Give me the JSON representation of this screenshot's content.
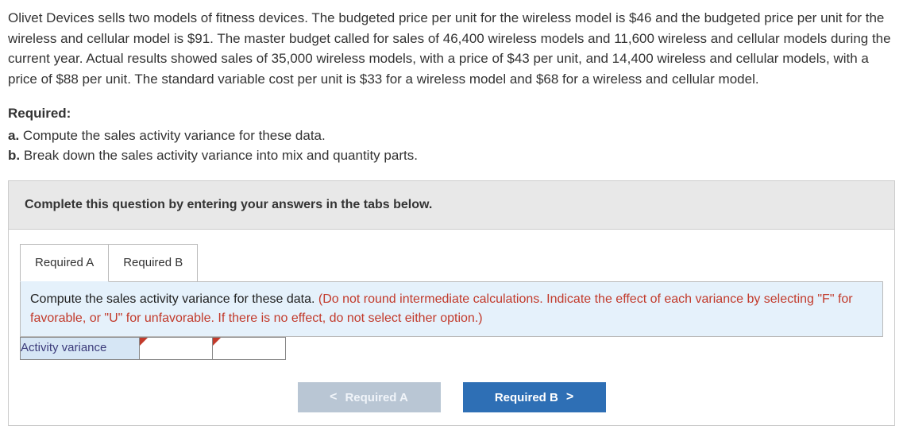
{
  "question": {
    "body": "Olivet Devices sells two models of fitness devices. The budgeted price per unit for the wireless model is $46 and the budgeted price per unit for the wireless and cellular model is $91. The master budget called for sales of 46,400 wireless models and 11,600 wireless and cellular models during the current year. Actual results showed sales of 35,000 wireless models, with a price of $43 per unit, and 14,400 wireless and cellular models, with a price of $88 per unit. The standard variable cost per unit is $33 for a wireless model and $68 for a wireless and cellular model."
  },
  "required": {
    "heading": "Required:",
    "items": [
      {
        "letter": "a.",
        "text": "Compute the sales activity variance for these data."
      },
      {
        "letter": "b.",
        "text": "Break down the sales activity variance into mix and quantity parts."
      }
    ]
  },
  "instruction": "Complete this question by entering your answers in the tabs below.",
  "tabs": {
    "a": "Required A",
    "b": "Required B"
  },
  "tabContent": {
    "black": "Compute the sales activity variance for these data. ",
    "red": "(Do not round intermediate calculations. Indicate the effect of each variance by selecting \"F\" for favorable, or \"U\" for unfavorable. If there is no effect, do not select either option.)"
  },
  "table": {
    "row_label": "Activity variance"
  },
  "nav": {
    "prev_icon": "<",
    "prev_label": "Required A",
    "next_label": "Required B",
    "next_icon": ">"
  }
}
